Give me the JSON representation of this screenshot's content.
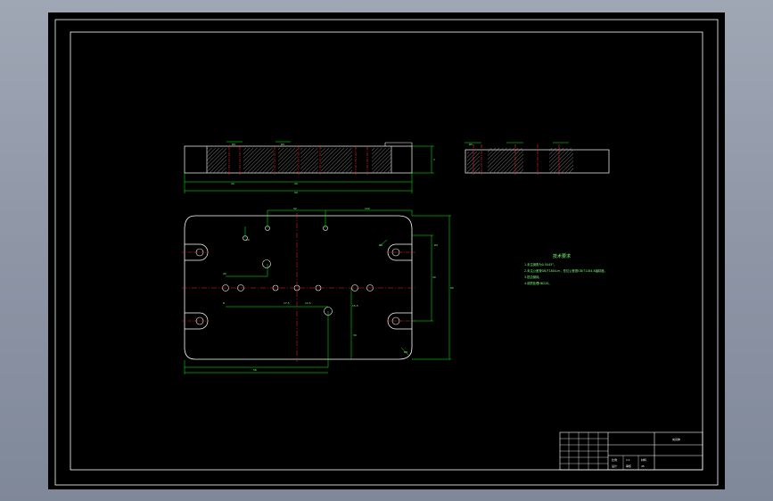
{
  "drawing": {
    "background": "#000000",
    "colors": {
      "frame": "#ffffff",
      "outline": "#ffffff",
      "dimension": "#00ff00",
      "centerline": "#ff2020",
      "hatch": "#cccccc",
      "text": "#7dff7d"
    },
    "technical_requirements": {
      "title": "技术要求",
      "lines": [
        "1.未注倒角为0.5X45°。",
        "2.未注公差按GB/T1804-m，形位公差按GB/T1184-K级精度。",
        "3.锐边倒钝。",
        "4.调质处理HB220。"
      ]
    },
    "dimensions": {
      "top_view": [
        "R5",
        "R5",
        "R5",
        "20",
        "40",
        "2",
        "90"
      ],
      "plan_view": [
        "50",
        "100",
        "10",
        "R6",
        "R6",
        "20",
        "8",
        "17.5",
        "12.5",
        "15.5",
        "30",
        "30",
        "56",
        "60",
        "R5"
      ]
    },
    "title_block": [
      "夹具体",
      "比例",
      "1:1",
      "材料",
      "45",
      "设计",
      "审核"
    ]
  }
}
